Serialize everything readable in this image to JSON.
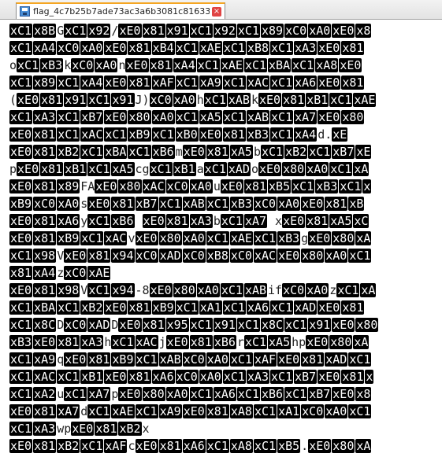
{
  "tab": {
    "title": "flag_4c7b25b7ade73ac3a6b3081c81633fe6",
    "close_label": "×"
  },
  "lines": [
    [
      [
        "t",
        "xC1"
      ],
      [
        "t",
        "x8B"
      ],
      [
        "p",
        "G"
      ],
      [
        "t",
        "xC1"
      ],
      [
        "t",
        "x92"
      ],
      [
        "p",
        "/"
      ],
      [
        "t",
        "xE0"
      ],
      [
        "t",
        "x81"
      ],
      [
        "t",
        "x91"
      ],
      [
        "t",
        "xC1"
      ],
      [
        "t",
        "x92"
      ],
      [
        "t",
        "xC1"
      ],
      [
        "t",
        "x89"
      ],
      [
        "t",
        "xC0"
      ],
      [
        "t",
        "xA0"
      ],
      [
        "t",
        "xE0"
      ],
      [
        "t",
        "x8"
      ]
    ],
    [
      [
        "t",
        "xC1"
      ],
      [
        "t",
        "xA4"
      ],
      [
        "t",
        "xC0"
      ],
      [
        "t",
        "xA0"
      ],
      [
        "t",
        "xE0"
      ],
      [
        "t",
        "x81"
      ],
      [
        "t",
        "xB4"
      ],
      [
        "t",
        "xC1"
      ],
      [
        "t",
        "xAE"
      ],
      [
        "t",
        "xC1"
      ],
      [
        "t",
        "xB8"
      ],
      [
        "t",
        "xC1"
      ],
      [
        "t",
        "xA3"
      ],
      [
        "t",
        "xE0"
      ],
      [
        "t",
        "x81"
      ]
    ],
    [
      [
        "p",
        "o"
      ],
      [
        "t",
        "xC1"
      ],
      [
        "t",
        "xB3"
      ],
      [
        "p",
        "k"
      ],
      [
        "t",
        "xC0"
      ],
      [
        "t",
        "xA0"
      ],
      [
        "p",
        "n"
      ],
      [
        "t",
        "xE0"
      ],
      [
        "t",
        "x81"
      ],
      [
        "t",
        "xA4"
      ],
      [
        "t",
        "xC1"
      ],
      [
        "t",
        "xAE"
      ],
      [
        "t",
        "xC1"
      ],
      [
        "t",
        "xBA"
      ],
      [
        "t",
        "xC1"
      ],
      [
        "t",
        "xA8"
      ],
      [
        "t",
        "xE0"
      ]
    ],
    [
      [
        "t",
        "xC1"
      ],
      [
        "t",
        "x89"
      ],
      [
        "t",
        "xC1"
      ],
      [
        "t",
        "xA4"
      ],
      [
        "t",
        "xE0"
      ],
      [
        "t",
        "x81"
      ],
      [
        "t",
        "xAF"
      ],
      [
        "t",
        "xC1"
      ],
      [
        "t",
        "xA9"
      ],
      [
        "t",
        "xC1"
      ],
      [
        "t",
        "xAC"
      ],
      [
        "t",
        "xC1"
      ],
      [
        "t",
        "xA6"
      ],
      [
        "t",
        "xE0"
      ],
      [
        "t",
        "x81"
      ]
    ],
    [
      [
        "p",
        "("
      ],
      [
        "t",
        "xE0"
      ],
      [
        "t",
        "x81"
      ],
      [
        "t",
        "x91"
      ],
      [
        "t",
        "xC1"
      ],
      [
        "t",
        "x91"
      ],
      [
        "p",
        "J)"
      ],
      [
        "t",
        "xC0"
      ],
      [
        "t",
        "xA0"
      ],
      [
        "p",
        "h"
      ],
      [
        "t",
        "xC1"
      ],
      [
        "t",
        "xAB"
      ],
      [
        "p",
        "k"
      ],
      [
        "t",
        "xE0"
      ],
      [
        "t",
        "x81"
      ],
      [
        "t",
        "xB1"
      ],
      [
        "t",
        "xC1"
      ],
      [
        "t",
        "xAE"
      ]
    ],
    [
      [
        "t",
        "xC1"
      ],
      [
        "t",
        "xA3"
      ],
      [
        "t",
        "xC1"
      ],
      [
        "t",
        "xB7"
      ],
      [
        "t",
        "xE0"
      ],
      [
        "t",
        "x80"
      ],
      [
        "t",
        "xA0"
      ],
      [
        "t",
        "xC1"
      ],
      [
        "t",
        "xA5"
      ],
      [
        "t",
        "xC1"
      ],
      [
        "t",
        "xAB"
      ],
      [
        "t",
        "xC1"
      ],
      [
        "t",
        "xA7"
      ],
      [
        "t",
        "xE0"
      ],
      [
        "t",
        "x80"
      ]
    ],
    [
      [
        "t",
        "xE0"
      ],
      [
        "t",
        "x81"
      ],
      [
        "t",
        "xC1"
      ],
      [
        "t",
        "xAC"
      ],
      [
        "t",
        "xC1"
      ],
      [
        "t",
        "xB9"
      ],
      [
        "t",
        "xC1"
      ],
      [
        "t",
        "xB0"
      ],
      [
        "t",
        "xE0"
      ],
      [
        "t",
        "x81"
      ],
      [
        "t",
        "xB3"
      ],
      [
        "t",
        "xC1"
      ],
      [
        "t",
        "xA4"
      ],
      [
        "p",
        "d."
      ],
      [
        "t",
        "xE"
      ]
    ],
    [
      [
        "t",
        "xE0"
      ],
      [
        "t",
        "x81"
      ],
      [
        "t",
        "xB2"
      ],
      [
        "t",
        "xC1"
      ],
      [
        "t",
        "xBA"
      ],
      [
        "t",
        "xC1"
      ],
      [
        "t",
        "xB6"
      ],
      [
        "p",
        "m"
      ],
      [
        "t",
        "xE0"
      ],
      [
        "t",
        "x81"
      ],
      [
        "t",
        "xA5"
      ],
      [
        "p",
        "b"
      ],
      [
        "t",
        "xC1"
      ],
      [
        "t",
        "xB2"
      ],
      [
        "t",
        "xC1"
      ],
      [
        "t",
        "xB7"
      ],
      [
        "t",
        "xE"
      ]
    ],
    [
      [
        "p",
        "p"
      ],
      [
        "t",
        "xE0"
      ],
      [
        "t",
        "x81"
      ],
      [
        "t",
        "xB1"
      ],
      [
        "t",
        "xC1"
      ],
      [
        "t",
        "xA5"
      ],
      [
        "p",
        "cg"
      ],
      [
        "t",
        "xC1"
      ],
      [
        "t",
        "xB1"
      ],
      [
        "p",
        "a"
      ],
      [
        "t",
        "xC1"
      ],
      [
        "t",
        "xAD"
      ],
      [
        "p",
        "o"
      ],
      [
        "t",
        "xE0"
      ],
      [
        "t",
        "x80"
      ],
      [
        "t",
        "xA0"
      ],
      [
        "t",
        "xC1"
      ],
      [
        "t",
        "xA"
      ]
    ],
    [
      [
        "t",
        "xE0"
      ],
      [
        "t",
        "x81"
      ],
      [
        "t",
        "x89"
      ],
      [
        "p",
        "FA"
      ],
      [
        "t",
        "xE0"
      ],
      [
        "t",
        "x80"
      ],
      [
        "t",
        "xAC"
      ],
      [
        "t",
        "xC0"
      ],
      [
        "t",
        "xA0"
      ],
      [
        "p",
        "u"
      ],
      [
        "t",
        "xE0"
      ],
      [
        "t",
        "x81"
      ],
      [
        "t",
        "xB5"
      ],
      [
        "t",
        "xC1"
      ],
      [
        "t",
        "xB3"
      ],
      [
        "t",
        "xC1"
      ],
      [
        "t",
        "x"
      ]
    ],
    [
      [
        "t",
        "xB9"
      ],
      [
        "t",
        "xC0"
      ],
      [
        "t",
        "xA0"
      ],
      [
        "p",
        "s"
      ],
      [
        "t",
        "xE0"
      ],
      [
        "t",
        "x81"
      ],
      [
        "t",
        "xB7"
      ],
      [
        "t",
        "xC1"
      ],
      [
        "t",
        "xAB"
      ],
      [
        "t",
        "xC1"
      ],
      [
        "t",
        "xB3"
      ],
      [
        "t",
        "xC0"
      ],
      [
        "t",
        "xA0"
      ],
      [
        "t",
        "xE0"
      ],
      [
        "t",
        "x81"
      ],
      [
        "t",
        "xB"
      ]
    ],
    [
      [
        "t",
        "xE0"
      ],
      [
        "t",
        "x81"
      ],
      [
        "t",
        "xA6"
      ],
      [
        "p",
        "y"
      ],
      [
        "t",
        "xC1"
      ],
      [
        "t",
        "xB6"
      ],
      [
        "p",
        " "
      ],
      [
        "t",
        "xE0"
      ],
      [
        "t",
        "x81"
      ],
      [
        "t",
        "xA3"
      ],
      [
        "p",
        "b"
      ],
      [
        "t",
        "xC1"
      ],
      [
        "t",
        "xA7"
      ],
      [
        "p",
        " x"
      ],
      [
        "t",
        "xE0"
      ],
      [
        "t",
        "x81"
      ],
      [
        "t",
        "xA5"
      ],
      [
        "t",
        "xC"
      ]
    ],
    [
      [
        "t",
        "xE0"
      ],
      [
        "t",
        "x81"
      ],
      [
        "t",
        "xB9"
      ],
      [
        "t",
        "xC1"
      ],
      [
        "t",
        "xAC"
      ],
      [
        "p",
        "v"
      ],
      [
        "t",
        "xE0"
      ],
      [
        "t",
        "x80"
      ],
      [
        "t",
        "xA0"
      ],
      [
        "t",
        "xC1"
      ],
      [
        "t",
        "xAE"
      ],
      [
        "t",
        "xC1"
      ],
      [
        "t",
        "xB3"
      ],
      [
        "p",
        "g"
      ],
      [
        "t",
        "xE0"
      ],
      [
        "t",
        "x80"
      ],
      [
        "t",
        "xA"
      ]
    ],
    [
      [
        "t",
        "xC1"
      ],
      [
        "t",
        "x98"
      ],
      [
        "p",
        "V"
      ],
      [
        "t",
        "xE0"
      ],
      [
        "t",
        "x81"
      ],
      [
        "t",
        "x94"
      ],
      [
        "t",
        "xC0"
      ],
      [
        "t",
        "xAD"
      ],
      [
        "t",
        "xC0"
      ],
      [
        "t",
        "xB8"
      ],
      [
        "t",
        "xC0"
      ],
      [
        "t",
        "xAC"
      ],
      [
        "t",
        "xE0"
      ],
      [
        "t",
        "x80"
      ],
      [
        "t",
        "xA0"
      ],
      [
        "t",
        "xC1"
      ]
    ],
    [
      [
        "t",
        "x81"
      ],
      [
        "t",
        "xA4"
      ],
      [
        "p",
        "z"
      ],
      [
        "t",
        "xC0"
      ],
      [
        "t",
        "xAE"
      ]
    ],
    [
      [
        "t",
        "xE0"
      ],
      [
        "t",
        "x81"
      ],
      [
        "t",
        "x98"
      ],
      [
        "p",
        "V"
      ],
      [
        "t",
        "xC1"
      ],
      [
        "t",
        "x94"
      ],
      [
        "p",
        "-8"
      ],
      [
        "t",
        "xE0"
      ],
      [
        "t",
        "x80"
      ],
      [
        "t",
        "xA0"
      ],
      [
        "t",
        "xC1"
      ],
      [
        "t",
        "xAB"
      ],
      [
        "p",
        "if"
      ],
      [
        "t",
        "xC0"
      ],
      [
        "t",
        "xA0"
      ],
      [
        "p",
        "z"
      ],
      [
        "t",
        "xC1"
      ],
      [
        "t",
        "xA"
      ]
    ],
    [
      [
        "t",
        "xC1"
      ],
      [
        "t",
        "xBA"
      ],
      [
        "t",
        "xC1"
      ],
      [
        "t",
        "xB2"
      ],
      [
        "t",
        "xE0"
      ],
      [
        "t",
        "x81"
      ],
      [
        "t",
        "xB9"
      ],
      [
        "t",
        "xC1"
      ],
      [
        "t",
        "xA1"
      ],
      [
        "t",
        "xC1"
      ],
      [
        "t",
        "xA6"
      ],
      [
        "t",
        "xC1"
      ],
      [
        "t",
        "xAD"
      ],
      [
        "t",
        "xE0"
      ],
      [
        "t",
        "x81"
      ]
    ],
    [
      [
        "t",
        "xC1"
      ],
      [
        "t",
        "x8C"
      ],
      [
        "p",
        "D"
      ],
      [
        "t",
        "xC0"
      ],
      [
        "t",
        "xAD"
      ],
      [
        "p",
        "D"
      ],
      [
        "t",
        "xE0"
      ],
      [
        "t",
        "x81"
      ],
      [
        "t",
        "x95"
      ],
      [
        "t",
        "xC1"
      ],
      [
        "t",
        "x91"
      ],
      [
        "t",
        "xC1"
      ],
      [
        "t",
        "x8C"
      ],
      [
        "t",
        "xC1"
      ],
      [
        "t",
        "x91"
      ],
      [
        "t",
        "xE0"
      ],
      [
        "t",
        "x80"
      ]
    ],
    [
      [
        "t",
        "xB3"
      ],
      [
        "t",
        "xE0"
      ],
      [
        "t",
        "x81"
      ],
      [
        "t",
        "xA3"
      ],
      [
        "p",
        "h"
      ],
      [
        "t",
        "xC1"
      ],
      [
        "t",
        "xAC"
      ],
      [
        "p",
        "j"
      ],
      [
        "t",
        "xE0"
      ],
      [
        "t",
        "x81"
      ],
      [
        "t",
        "xB6"
      ],
      [
        "p",
        "r"
      ],
      [
        "t",
        "xC1"
      ],
      [
        "t",
        "xA5"
      ],
      [
        "p",
        "hp"
      ],
      [
        "t",
        "xE0"
      ],
      [
        "t",
        "x80"
      ],
      [
        "t",
        "xA"
      ]
    ],
    [
      [
        "t",
        "xC1"
      ],
      [
        "t",
        "xA9"
      ],
      [
        "p",
        "q"
      ],
      [
        "t",
        "xE0"
      ],
      [
        "t",
        "x81"
      ],
      [
        "t",
        "xB9"
      ],
      [
        "t",
        "xC1"
      ],
      [
        "t",
        "xAB"
      ],
      [
        "t",
        "xC0"
      ],
      [
        "t",
        "xA0"
      ],
      [
        "t",
        "xC1"
      ],
      [
        "t",
        "xAF"
      ],
      [
        "t",
        "xE0"
      ],
      [
        "t",
        "x81"
      ],
      [
        "t",
        "xAD"
      ],
      [
        "t",
        "xC1"
      ]
    ],
    [
      [
        "t",
        "xC1"
      ],
      [
        "t",
        "xAC"
      ],
      [
        "t",
        "xC1"
      ],
      [
        "t",
        "xB1"
      ],
      [
        "t",
        "xE0"
      ],
      [
        "t",
        "x81"
      ],
      [
        "t",
        "xA6"
      ],
      [
        "t",
        "xC0"
      ],
      [
        "t",
        "xA0"
      ],
      [
        "t",
        "xC1"
      ],
      [
        "t",
        "xA3"
      ],
      [
        "t",
        "xC1"
      ],
      [
        "t",
        "xB7"
      ],
      [
        "t",
        "xE0"
      ],
      [
        "t",
        "x81"
      ],
      [
        "t",
        "x"
      ]
    ],
    [
      [
        "t",
        "xC1"
      ],
      [
        "t",
        "xA2"
      ],
      [
        "p",
        "u"
      ],
      [
        "t",
        "xC1"
      ],
      [
        "t",
        "xA7"
      ],
      [
        "p",
        "p"
      ],
      [
        "t",
        "xE0"
      ],
      [
        "t",
        "x80"
      ],
      [
        "t",
        "xA0"
      ],
      [
        "t",
        "xC1"
      ],
      [
        "t",
        "xA6"
      ],
      [
        "t",
        "xC1"
      ],
      [
        "t",
        "xB6"
      ],
      [
        "t",
        "xC1"
      ],
      [
        "t",
        "xB7"
      ],
      [
        "t",
        "xE0"
      ],
      [
        "t",
        "x8"
      ]
    ],
    [
      [
        "t",
        "xE0"
      ],
      [
        "t",
        "x81"
      ],
      [
        "t",
        "xA7"
      ],
      [
        "p",
        "d"
      ],
      [
        "t",
        "xC1"
      ],
      [
        "t",
        "xAE"
      ],
      [
        "t",
        "xC1"
      ],
      [
        "t",
        "xA9"
      ],
      [
        "t",
        "xE0"
      ],
      [
        "t",
        "x81"
      ],
      [
        "t",
        "xA8"
      ],
      [
        "t",
        "xC1"
      ],
      [
        "t",
        "xA1"
      ],
      [
        "t",
        "xC0"
      ],
      [
        "t",
        "xA0"
      ],
      [
        "t",
        "xC1"
      ]
    ],
    [
      [
        "t",
        "xC1"
      ],
      [
        "t",
        "xA3"
      ],
      [
        "p",
        "wp"
      ],
      [
        "t",
        "xE0"
      ],
      [
        "t",
        "x81"
      ],
      [
        "t",
        "xB2"
      ],
      [
        "p",
        "x"
      ]
    ],
    [
      [
        "t",
        "xE0"
      ],
      [
        "t",
        "x81"
      ],
      [
        "t",
        "xB2"
      ],
      [
        "t",
        "xC1"
      ],
      [
        "t",
        "xAF"
      ],
      [
        "p",
        "c"
      ],
      [
        "t",
        "xE0"
      ],
      [
        "t",
        "x81"
      ],
      [
        "t",
        "xA6"
      ],
      [
        "t",
        "xC1"
      ],
      [
        "t",
        "xA8"
      ],
      [
        "t",
        "xC1"
      ],
      [
        "t",
        "xB5"
      ],
      [
        "p",
        "."
      ],
      [
        "t",
        "xE0"
      ],
      [
        "t",
        "x80"
      ],
      [
        "t",
        "xA"
      ]
    ]
  ]
}
